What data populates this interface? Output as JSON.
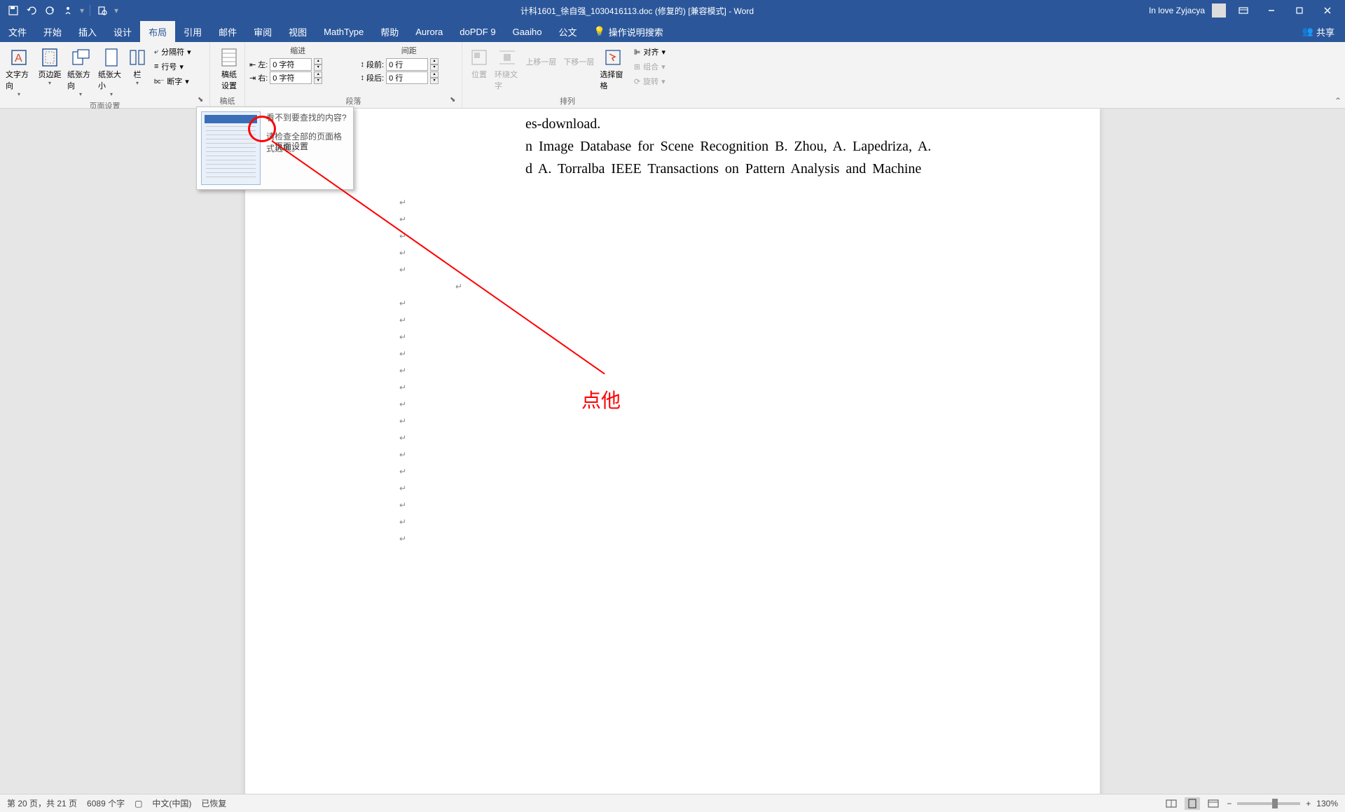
{
  "titlebar": {
    "title": "计科1601_徐自强_1030416113.doc (修复的) [兼容模式] - Word",
    "user": "In love Zyjacya"
  },
  "menu": {
    "items": [
      "文件",
      "开始",
      "插入",
      "设计",
      "布局",
      "引用",
      "邮件",
      "审阅",
      "视图",
      "MathType",
      "帮助",
      "Aurora",
      "doPDF 9",
      "Gaaiho",
      "公文"
    ],
    "active_index": 4,
    "tell_me": "操作说明搜索",
    "share": "共享"
  },
  "ribbon": {
    "page_setup": {
      "label": "页面设置",
      "text_direction": "文字方向",
      "margins": "页边距",
      "orientation": "纸张方向",
      "size": "纸张大小",
      "columns": "栏",
      "breaks": "分隔符",
      "line_numbers": "行号",
      "hyphenation": "断字"
    },
    "manuscript": {
      "label": "稿纸",
      "settings": "稿纸\n设置"
    },
    "paragraph": {
      "label": "段落",
      "indent_header": "缩进",
      "spacing_header": "间距",
      "left_label": "左:",
      "right_label": "右:",
      "before_label": "段前:",
      "after_label": "段后:",
      "left_val": "0 字符",
      "right_val": "0 字符",
      "before_val": "0 行",
      "after_val": "0 行"
    },
    "arrange": {
      "label": "排列",
      "position": "位置",
      "wrap": "环绕文字",
      "forward": "上移一层",
      "backward": "下移一层",
      "selection_pane": "选择窗格",
      "align": "对齐",
      "group": "组合",
      "rotate": "旋转"
    }
  },
  "tooltip": {
    "title": "页面设置",
    "question": "看不到要查找的内容?",
    "description": "请检查全部的页面格式选项。"
  },
  "document": {
    "line1": "es-download.",
    "line2": "n Image Database for Scene Recognition B. Zhou, A. Lapedriza, A.",
    "line3": "d A. Torralba IEEE Transactions on Pattern Analysis and Machine"
  },
  "annotation": {
    "text": "点他"
  },
  "statusbar": {
    "page": "第 20 页，共 21 页",
    "words": "6089 个字",
    "language": "中文(中国)",
    "recovered": "已恢复",
    "zoom": "130%"
  }
}
